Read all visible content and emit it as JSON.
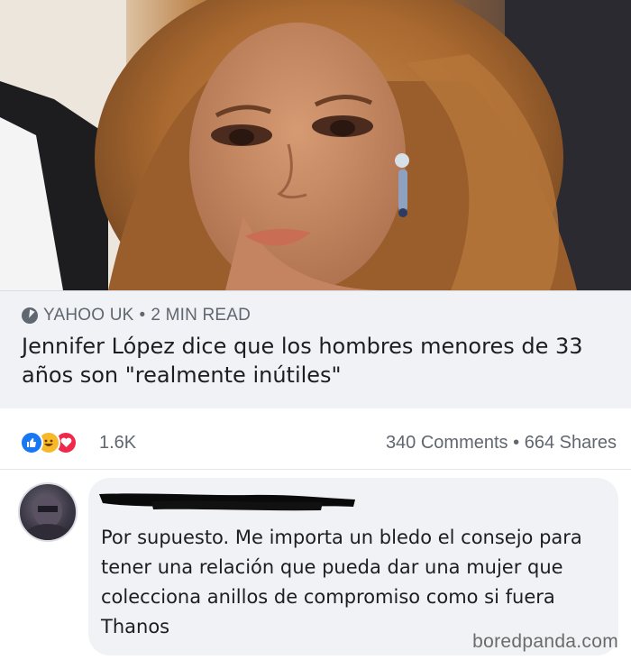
{
  "link_preview": {
    "source": "YAHOO UK",
    "separator": "•",
    "read_time": "2 MIN READ",
    "headline": "Jennifer López dice que los hombres menores de 33 años son \"realmente inútiles\""
  },
  "reactions": {
    "icons": [
      "like-icon",
      "haha-icon",
      "love-icon"
    ],
    "count": "1.6K",
    "comments": "340 Comments",
    "separator": "•",
    "shares": "664 Shares"
  },
  "comment": {
    "text": "Por supuesto. Me importa un bledo el consejo para tener una relación que pueda dar una mujer que colecciona anillos de compromiso como si fuera Thanos"
  },
  "watermark": "boredpanda.com",
  "colors": {
    "card_bg": "#f0f2f5",
    "like": "#1877f2",
    "haha": "#f7b928",
    "love": "#f0284a",
    "meta_text": "#606770"
  }
}
